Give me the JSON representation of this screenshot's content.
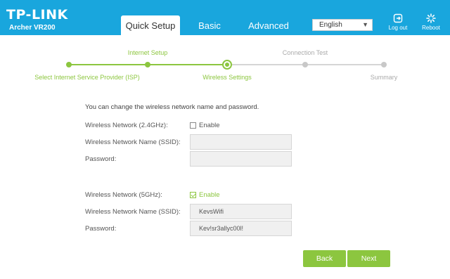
{
  "header": {
    "brand": "TP-LINK",
    "model": "Archer VR200",
    "tabs": [
      {
        "label": "Quick Setup",
        "active": true
      },
      {
        "label": "Basic",
        "active": false
      },
      {
        "label": "Advanced",
        "active": false
      }
    ],
    "language": "English",
    "logout_label": "Log out",
    "reboot_label": "Reboot"
  },
  "stepper": {
    "steps": [
      {
        "label": "Select Internet Service Provider (ISP)",
        "state": "done"
      },
      {
        "label": "Internet Setup",
        "state": "done"
      },
      {
        "label": "Wireless Settings",
        "state": "current"
      },
      {
        "label": "Connection Test",
        "state": "todo"
      },
      {
        "label": "Summary",
        "state": "todo"
      }
    ]
  },
  "form": {
    "intro": "You can change the wireless network name and password.",
    "band24": {
      "network_label": "Wireless Network (2.4GHz):",
      "enable_label": "Enable",
      "enabled": false,
      "ssid_label": "Wireless Network Name (SSID):",
      "ssid_value": "",
      "password_label": "Password:",
      "password_value": ""
    },
    "band5": {
      "network_label": "Wireless Network (5GHz):",
      "enable_label": "Enable",
      "enabled": true,
      "ssid_label": "Wireless Network Name (SSID):",
      "ssid_value": "KevsWifi",
      "password_label": "Password:",
      "password_value": "Kev!sr3allyc00l!"
    }
  },
  "buttons": {
    "back": "Back",
    "next": "Next"
  },
  "colors": {
    "header_blue": "#19a6dd",
    "accent_green": "#8cc63f",
    "inactive_grey": "#c8c8c8"
  }
}
